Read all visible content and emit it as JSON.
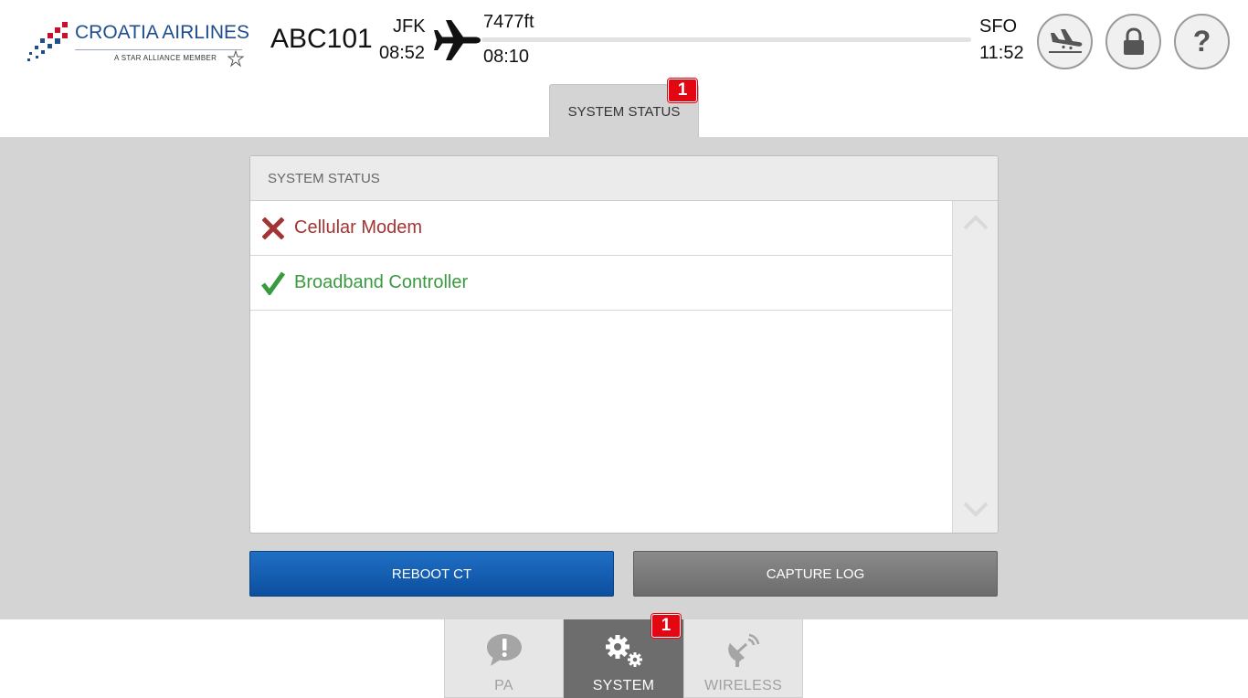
{
  "header": {
    "brand_name": "CROATIA AIRLINES",
    "brand_tagline": "A STAR ALLIANCE MEMBER",
    "flight_number": "ABC101",
    "origin": {
      "code": "JFK",
      "time": "08:52"
    },
    "altitude": "7477ft",
    "elapsed_time": "08:10",
    "destination": {
      "code": "SFO",
      "time": "11:52"
    },
    "buttons": {
      "landing_icon": "plane-landing-icon",
      "lock_icon": "lock-icon",
      "help_label": "?"
    }
  },
  "top_tab": {
    "label": "SYSTEM STATUS",
    "badge": "1"
  },
  "panel": {
    "title": "SYSTEM STATUS",
    "items": [
      {
        "label": "Cellular Modem",
        "status": "error",
        "icon": "x-mark-icon",
        "color": "#a33434"
      },
      {
        "label": "Broadband Controller",
        "status": "ok",
        "icon": "check-mark-icon",
        "color": "#3a9a3f"
      }
    ]
  },
  "actions": {
    "reboot_label": "REBOOT CT",
    "capture_label": "CAPTURE LOG"
  },
  "bottom_nav": {
    "tabs": [
      {
        "label": "PA",
        "icon": "speech-bubble-exclamation-icon",
        "active": false
      },
      {
        "label": "SYSTEM",
        "icon": "gears-icon",
        "active": true
      },
      {
        "label": "WIRELESS",
        "icon": "satellite-dish-icon",
        "active": false
      }
    ],
    "system_badge": "1"
  },
  "colors": {
    "brand_blue": "#1f4e8c",
    "brand_red": "#c8102e",
    "badge_red": "#e30613",
    "primary_button": "#0c5aab",
    "secondary_button": "#777777",
    "error": "#a33434",
    "success": "#3a9a3f"
  }
}
